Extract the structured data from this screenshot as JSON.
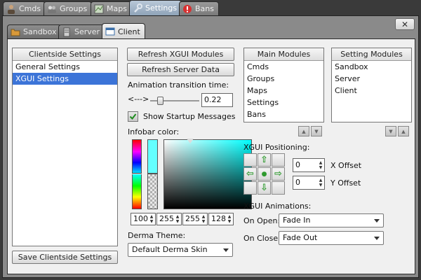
{
  "top_tabs": [
    {
      "label": "Cmds",
      "icon": "people-icon"
    },
    {
      "label": "Groups",
      "icon": "group-icon"
    },
    {
      "label": "Maps",
      "icon": "map-icon"
    },
    {
      "label": "Settings",
      "icon": "wrench-icon"
    },
    {
      "label": "Bans",
      "icon": "stop-icon"
    }
  ],
  "active_top_tab": "Settings",
  "close_label": "✕",
  "sub_tabs": [
    {
      "label": "Sandbox",
      "icon": "folder-icon"
    },
    {
      "label": "Server",
      "icon": "server-icon"
    },
    {
      "label": "Client",
      "icon": "window-icon"
    }
  ],
  "active_sub_tab": "Client",
  "clientside": {
    "header": "Clientside Settings",
    "items": [
      "General Settings",
      "XGUI Settings"
    ],
    "selected": "XGUI Settings",
    "save_label": "Save Clientside Settings"
  },
  "buttons": {
    "refresh_xgui": "Refresh XGUI Modules",
    "refresh_server": "Refresh Server Data"
  },
  "animation": {
    "label": "Animation transition time:",
    "slider_left_label": "<--->",
    "value": "0.22",
    "slider_fraction": 0.22
  },
  "startup": {
    "label": "Show Startup Messages",
    "checked": true
  },
  "infobar": {
    "label": "Infobar color:",
    "color": "#64ffff",
    "rgba": [
      "100",
      "255",
      "255",
      "128"
    ]
  },
  "derma": {
    "label": "Derma Theme:",
    "value": "Default Derma Skin"
  },
  "main_modules": {
    "header": "Main Modules",
    "items": [
      "Cmds",
      "Groups",
      "Maps",
      "Settings",
      "Bans"
    ]
  },
  "setting_modules": {
    "header": "Setting Modules",
    "items": [
      "Sandbox",
      "Server",
      "Client"
    ]
  },
  "positioning": {
    "label": "XGUI Positioning:",
    "x_value": "0",
    "x_label": "X Offset",
    "y_value": "0",
    "y_label": "Y Offset"
  },
  "animations": {
    "label": "XGUI Animations:",
    "open_label": "On Open:",
    "open_value": "Fade In",
    "close_label": "On Close:",
    "close_value": "Fade Out"
  }
}
